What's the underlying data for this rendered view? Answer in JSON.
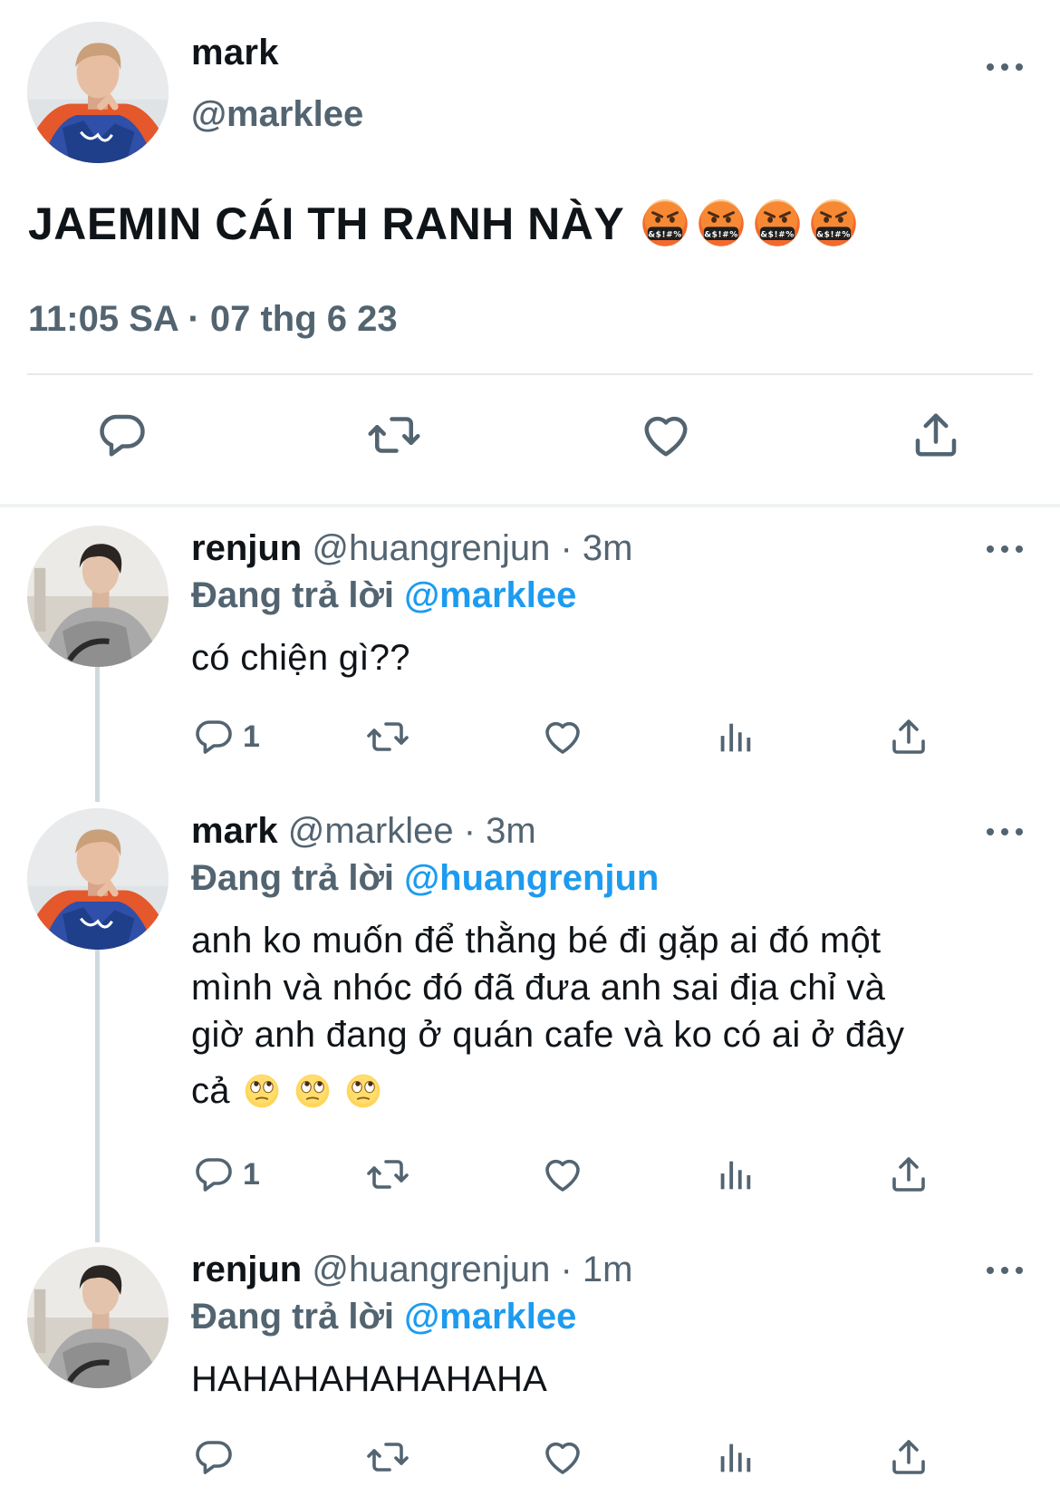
{
  "main_tweet": {
    "name": "mark",
    "handle": "@marklee",
    "text": "JAEMIN CÁI TH RANH NÀY",
    "emojis": [
      "face-with-symbols-on-mouth",
      "face-with-symbols-on-mouth",
      "face-with-symbols-on-mouth",
      "face-with-symbols-on-mouth"
    ],
    "timestamp": "11:05 SA · 07 thg 6 23",
    "actions": [
      "reply-icon",
      "retweet-icon",
      "like-icon",
      "share-icon"
    ]
  },
  "replies": [
    {
      "name": "renjun",
      "handle_time": "@huangrenjun · 3m",
      "replying_prefix": "Đang trả lời",
      "replying_to": "@marklee",
      "text": "có chiện gì??",
      "reply_count": "1"
    },
    {
      "name": "mark",
      "handle_time": "@marklee · 3m",
      "replying_prefix": "Đang trả lời",
      "replying_to": "@huangrenjun",
      "text_lines": [
        "anh ko muốn để thằng bé đi gặp ai đó một",
        "mình và nhóc đó đã đưa anh sai địa chỉ và",
        "giờ anh đang ở quán cafe và ko có ai ở đây",
        "cả"
      ],
      "emojis": [
        "face-with-rolling-eyes",
        "face-with-rolling-eyes",
        "face-with-rolling-eyes"
      ],
      "reply_count": "1"
    },
    {
      "name": "renjun",
      "handle_time": "@huangrenjun · 1m",
      "replying_prefix": "Đang trả lời",
      "replying_to": "@marklee",
      "text": "HAHAHAHAHAHAHA",
      "reply_count": ""
    }
  ],
  "colors": {
    "text": "#0f1419",
    "secondary": "#536471",
    "accent": "#1d9bf0",
    "divider": "#e7e9ea"
  }
}
